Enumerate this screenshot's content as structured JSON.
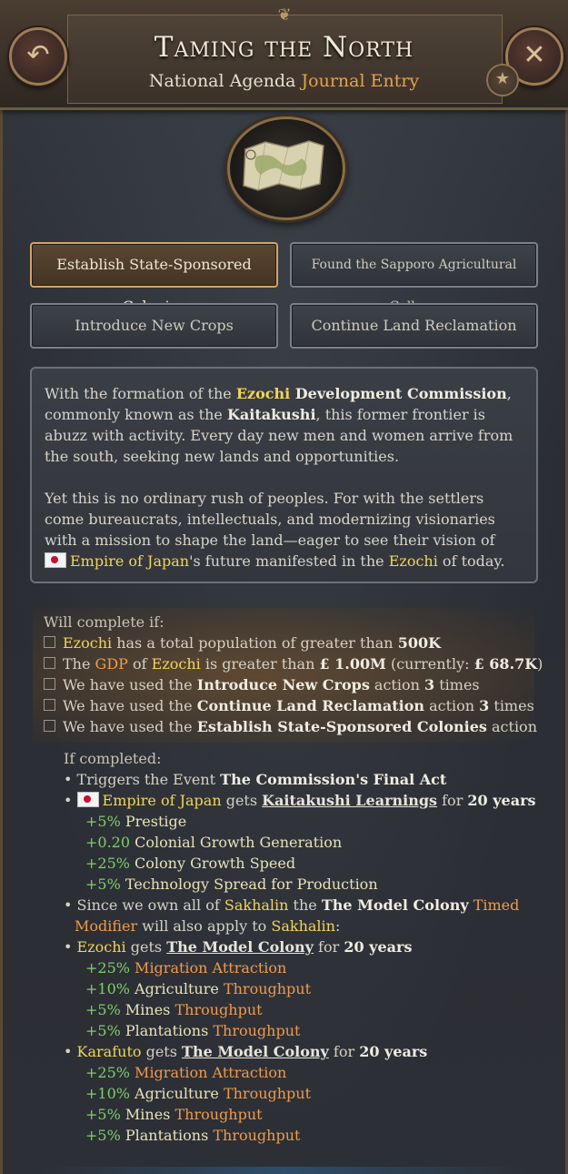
{
  "header": {
    "title": "Taming the North",
    "subtitle_main": "National Agenda",
    "subtitle_accent": "Journal Entry"
  },
  "icons": {
    "back": "back-arrow-icon",
    "close": "close-icon",
    "star": "star-icon",
    "emblem": "map-icon"
  },
  "actions": [
    {
      "label": "Establish State-Sponsored Colonies"
    },
    {
      "label": "Found the Sapporo Agricultural College"
    },
    {
      "label": "Introduce New Crops"
    },
    {
      "label": "Continue Land Reclamation"
    }
  ],
  "description": {
    "p1": {
      "t1": "With the formation of the ",
      "ezochi": "Ezochi",
      "commission": " Development Commission",
      "t2": ", commonly known as the ",
      "kaitakushi": "Kaitakushi",
      "t3": ", this former frontier is abuzz with activity. Every day new men and women arrive from the south, seeking new lands and opportunities."
    },
    "p2": {
      "t1": "Yet this is no ordinary rush of peoples. For with the settlers come bureaucrats, intellectuals, and modernizing visionaries with a mission to shape the land—eager to see their vision of ",
      "empire": "Empire of Japan",
      "t2": "'s future manifested in the ",
      "ezochi": "Ezochi",
      "t3": " of today."
    }
  },
  "conditions": {
    "header": "Will complete if:",
    "c1": {
      "region": "Ezochi",
      "text": " has a total population of greater than ",
      "value": "500K"
    },
    "c2": {
      "pre": "The ",
      "gdp": "GDP",
      "of": " of ",
      "region": "Ezochi",
      "text": " is greater than  ",
      "value": "£ 1.00M",
      "current_pre": " (currently:  ",
      "current": "£ 68.7K",
      "close": ")"
    },
    "c3": {
      "pre": "We have used the ",
      "action": "Introduce New Crops",
      "mid": " action ",
      "count": "3",
      "post": " times"
    },
    "c4": {
      "pre": "We have used the ",
      "action": "Continue Land Reclamation",
      "mid": " action ",
      "count": "3",
      "post": " times"
    },
    "c5": {
      "pre": "We have used the ",
      "action": "Establish State-Sponsored Colonies",
      "post": " action"
    }
  },
  "outcome": {
    "header": "If completed:",
    "event": {
      "pre": "• Triggers the Event ",
      "name": "The Commission's Final Act"
    },
    "japan": {
      "bullet": "• ",
      "country": "Empire of Japan",
      "gets": " gets ",
      "modifier": "Kaitakushi Learnings",
      "for": " for ",
      "duration": "20 years"
    },
    "japan_effects": [
      {
        "value": "+5%",
        "name": " Prestige"
      },
      {
        "value": "+0.20",
        "name": " Colonial Growth Generation"
      },
      {
        "value": "+25%",
        "name": " Colony Growth Speed"
      },
      {
        "value": "+5%",
        "name": " Technology Spread for Production"
      }
    ],
    "since": {
      "pre": "• Since we own all of ",
      "region": "Sakhalin",
      "the": " the ",
      "colony": "The Model Colony",
      "timed": " Timed",
      "modifier": "Modifier",
      "apply": " will also apply to ",
      "region2": "Sakhalin",
      "colon": ":"
    },
    "ezochi": {
      "bullet": "• ",
      "region": "Ezochi",
      "gets": " gets ",
      "modifier": "The Model Colony",
      "for": " for ",
      "duration": "20 years"
    },
    "ezochi_effects": [
      {
        "value": "+25%",
        "name": " Migration Attraction",
        "suffix": ""
      },
      {
        "value": "+10%",
        "name": " Agriculture",
        "suffix": " Throughput"
      },
      {
        "value": "+5%",
        "name": " Mines",
        "suffix": " Throughput"
      },
      {
        "value": "+5%",
        "name": " Plantations",
        "suffix": " Throughput"
      }
    ],
    "karafuto": {
      "bullet": "• ",
      "region": "Karafuto",
      "gets": " gets ",
      "modifier": "The Model Colony",
      "for": " for ",
      "duration": "20 years"
    },
    "karafuto_effects": [
      {
        "value": "+25%",
        "name": " Migration Attraction",
        "suffix": ""
      },
      {
        "value": "+10%",
        "name": " Agriculture",
        "suffix": " Throughput"
      },
      {
        "value": "+5%",
        "name": " Mines",
        "suffix": " Throughput"
      },
      {
        "value": "+5%",
        "name": " Plantations",
        "suffix": " Throughput"
      }
    ]
  }
}
